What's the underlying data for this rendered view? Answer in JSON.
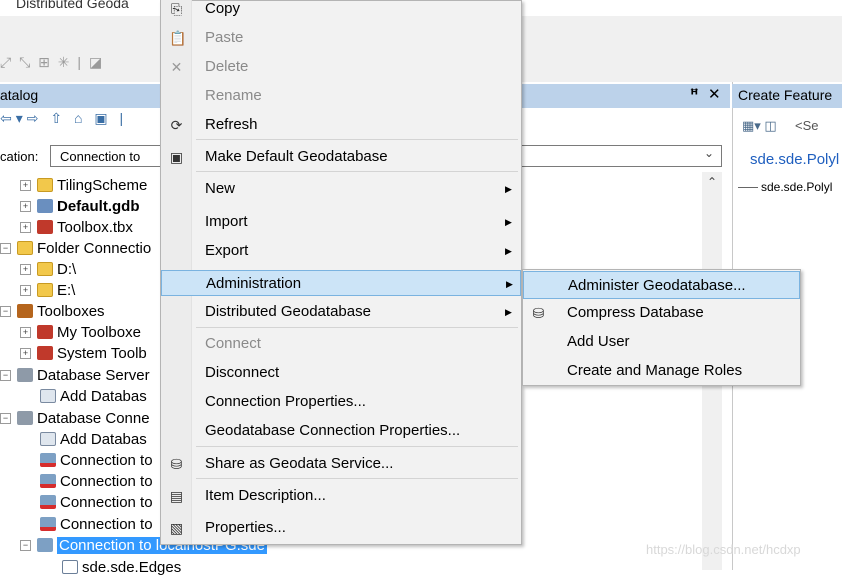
{
  "app": {
    "title_fragment": "Distributed Geoda",
    "toolbar_glyphs": "⤢ ⤡ ⊞ ✳ | ◪"
  },
  "catalog": {
    "title": "atalog",
    "pin_icon": "pin-icon",
    "pin_glyph": "ꟸ",
    "close_glyph": "✕",
    "toolbar_glyphs": "⇦▾⇨ ⇧ ⌂ ▣ |",
    "location_label": "cation:",
    "location_value": "Connection to",
    "dropdown_glyph": "⌄",
    "scroll_up_glyph": "⌃",
    "tree": [
      {
        "label": "TilingScheme",
        "expander": "+",
        "icon": "folder-icon",
        "bold": false
      },
      {
        "label": "Default.gdb",
        "expander": "+",
        "icon": "geodatabase-icon",
        "bold": true
      },
      {
        "label": "Toolbox.tbx",
        "expander": "+",
        "icon": "toolbox-icon",
        "bold": false
      },
      {
        "label": "Folder Connectio",
        "expander": "−",
        "icon": "folder-connection-icon",
        "bold": false
      },
      {
        "label": "D:\\",
        "expander": "+",
        "icon": "folder-icon",
        "bold": false
      },
      {
        "label": "E:\\",
        "expander": "+",
        "icon": "folder-icon",
        "bold": false
      },
      {
        "label": "Toolboxes",
        "expander": "−",
        "icon": "toolboxes-icon",
        "bold": false
      },
      {
        "label": "My Toolboxe",
        "expander": "+",
        "icon": "toolbox-icon",
        "bold": false
      },
      {
        "label": "System Toolb",
        "expander": "+",
        "icon": "toolbox-icon",
        "bold": false
      },
      {
        "label": "Database Server",
        "expander": "−",
        "icon": "database-server-icon",
        "bold": false
      },
      {
        "label": "Add Databas",
        "expander": "",
        "icon": "add-database-server-icon",
        "bold": false
      },
      {
        "label": "Database Conne",
        "expander": "−",
        "icon": "database-connections-icon",
        "bold": false
      },
      {
        "label": "Add Databas",
        "expander": "",
        "icon": "add-database-connection-icon",
        "bold": false
      },
      {
        "label": "Connection to",
        "expander": "",
        "icon": "broken-connection-icon",
        "bold": false
      },
      {
        "label": "Connection to",
        "expander": "",
        "icon": "broken-connection-icon",
        "bold": false
      },
      {
        "label": "Connection to",
        "expander": "",
        "icon": "broken-connection-icon",
        "bold": false
      },
      {
        "label": "Connection to",
        "expander": "",
        "icon": "broken-connection-icon",
        "bold": false
      },
      {
        "label": "Connection to localhostPG.sde",
        "expander": "−",
        "icon": "database-connection-icon",
        "bold": false,
        "selected": true
      },
      {
        "label": "sde.sde.Edges",
        "expander": "",
        "icon": "feature-class-icon",
        "bold": false
      }
    ]
  },
  "create_features": {
    "title": "Create Feature",
    "toolbar_glyph": "▦▾ ◫",
    "search_placeholder": "<Se",
    "template_group": "sde.sde.Polyl",
    "template_item": "sde.sde.Polyl"
  },
  "context_menu": {
    "items": [
      {
        "label": "Copy",
        "icon": "copy-icon",
        "glyph": "⎘",
        "disabled": false
      },
      {
        "label": "Paste",
        "icon": "paste-icon",
        "glyph": "📋",
        "disabled": true
      },
      {
        "label": "Delete",
        "icon": "delete-icon",
        "glyph": "✕",
        "disabled": true
      },
      {
        "label": "Rename",
        "icon": "",
        "glyph": "",
        "disabled": true
      },
      {
        "label": "Refresh",
        "icon": "refresh-icon",
        "glyph": "⟳",
        "disabled": false
      },
      {
        "label": "Make Default Geodatabase",
        "icon": "geodatabase-icon",
        "glyph": "▣",
        "disabled": false
      },
      {
        "label": "New",
        "icon": "",
        "glyph": "",
        "disabled": false,
        "submenu": true
      },
      {
        "label": "Import",
        "icon": "",
        "glyph": "",
        "disabled": false,
        "submenu": true
      },
      {
        "label": "Export",
        "icon": "",
        "glyph": "",
        "disabled": false,
        "submenu": true
      },
      {
        "label": "Administration",
        "icon": "",
        "glyph": "",
        "disabled": false,
        "submenu": true,
        "highlighted": true
      },
      {
        "label": "Distributed Geodatabase",
        "icon": "",
        "glyph": "",
        "disabled": false,
        "submenu": true
      },
      {
        "label": "Connect",
        "icon": "",
        "glyph": "",
        "disabled": true
      },
      {
        "label": "Disconnect",
        "icon": "",
        "glyph": "",
        "disabled": false
      },
      {
        "label": "Connection Properties...",
        "icon": "",
        "glyph": "",
        "disabled": false
      },
      {
        "label": "Geodatabase Connection Properties...",
        "icon": "",
        "glyph": "",
        "disabled": false
      },
      {
        "label": "Share as Geodata Service...",
        "icon": "share-service-icon",
        "glyph": "⛁",
        "disabled": false
      },
      {
        "label": "Item Description...",
        "icon": "item-description-icon",
        "glyph": "▤",
        "disabled": false
      },
      {
        "label": "Properties...",
        "icon": "properties-icon",
        "glyph": "▧",
        "disabled": false
      }
    ],
    "submenu_arrow": "▶"
  },
  "administration_submenu": {
    "items": [
      {
        "label": "Administer Geodatabase...",
        "icon": "",
        "glyph": "",
        "highlighted": true
      },
      {
        "label": "Compress Database",
        "icon": "compress-database-icon",
        "glyph": "⛁"
      },
      {
        "label": "Add User",
        "icon": "",
        "glyph": ""
      },
      {
        "label": "Create and Manage Roles",
        "icon": "",
        "glyph": ""
      }
    ]
  },
  "watermark": "https://blog.csdn.net/hcdxp",
  "colors": {
    "menu_bg": "#f2f2f2",
    "highlight_bg": "#cce4f7",
    "highlight_border": "#7ab3e0",
    "pane_header": "#bcd2ea",
    "selection": "#3399ff"
  }
}
